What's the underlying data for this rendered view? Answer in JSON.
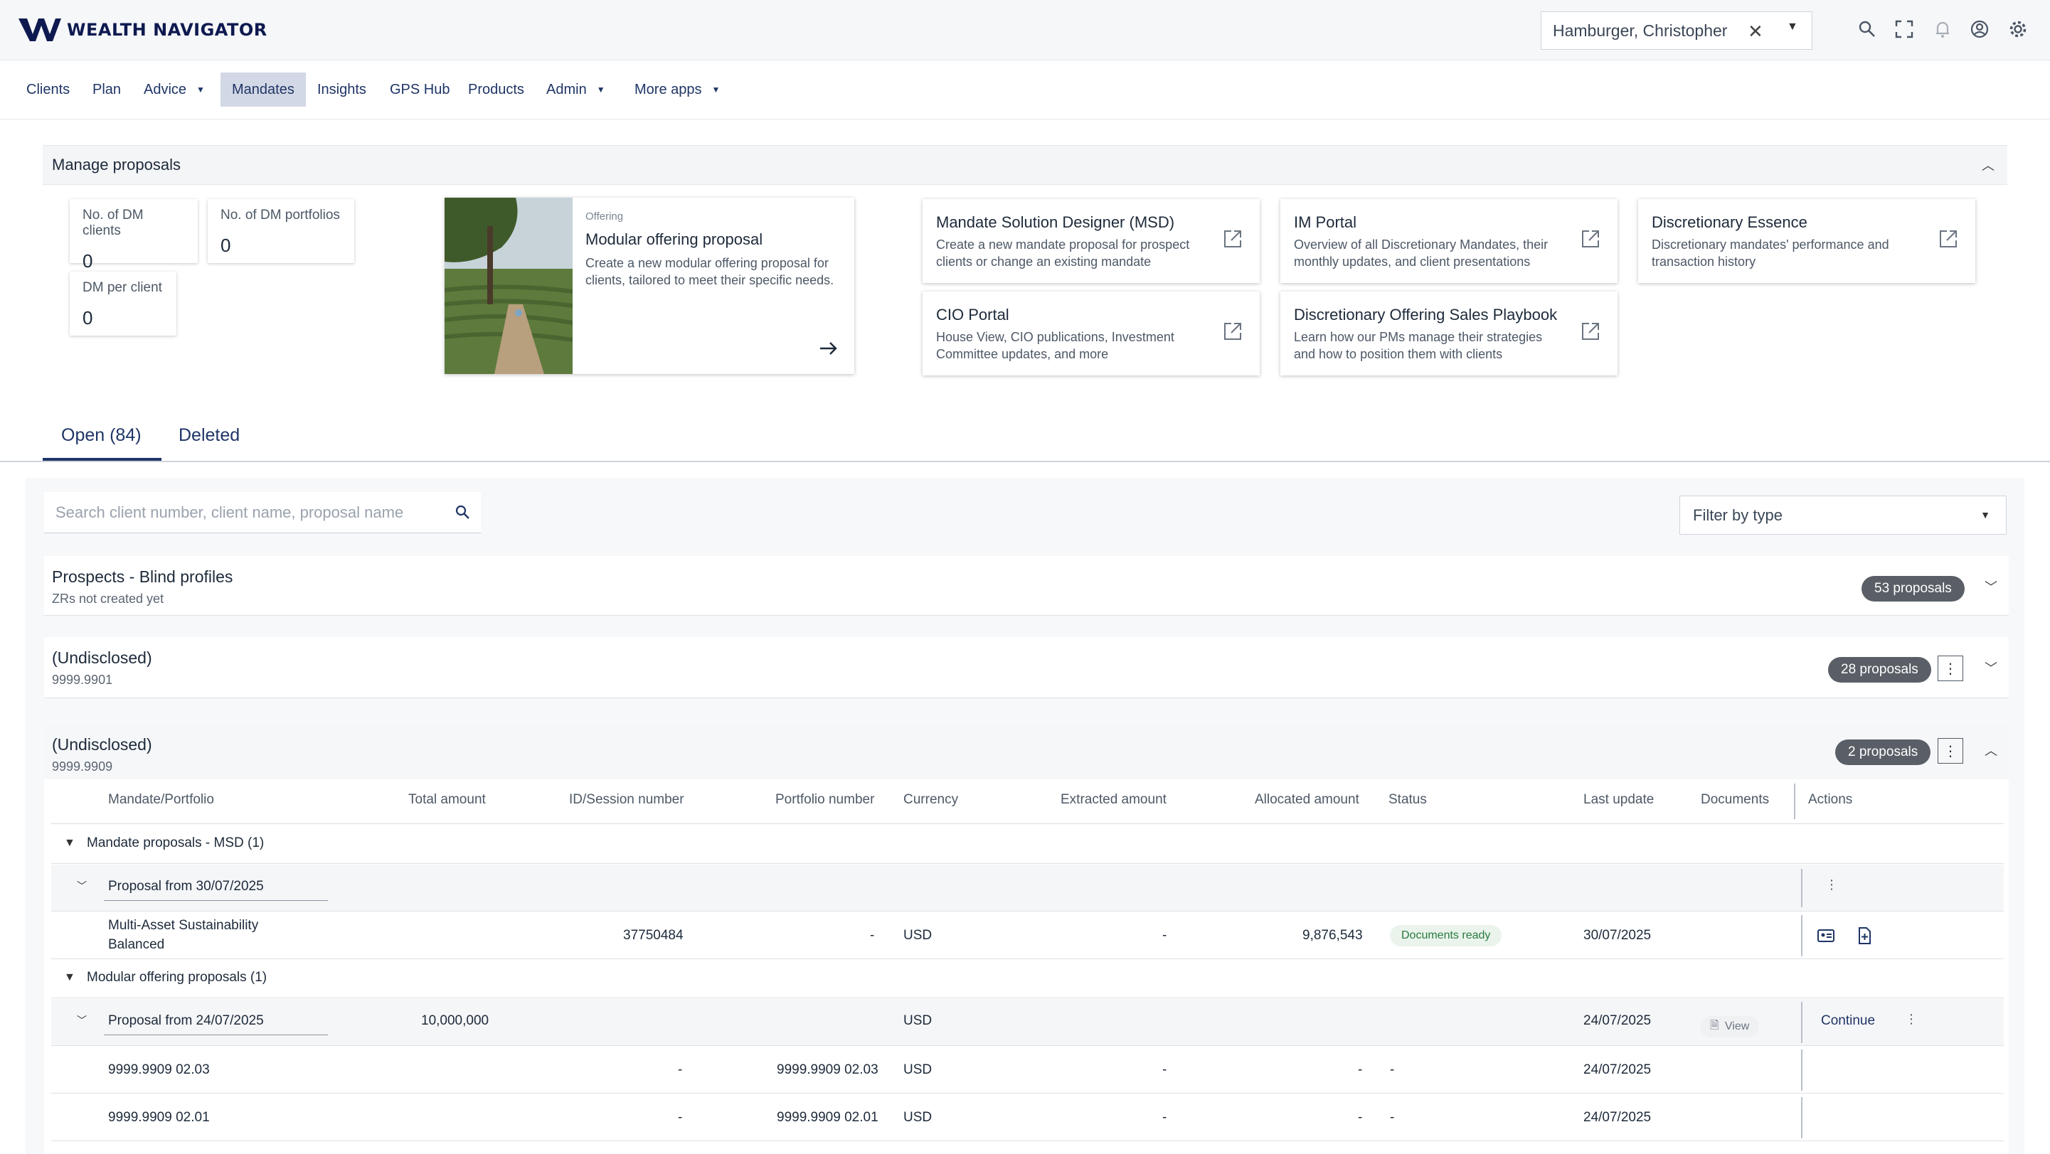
{
  "header": {
    "logo_text": "WEALTH NAVIGATOR",
    "client_name": "Hamburger, Christopher"
  },
  "nav": {
    "items": [
      {
        "label": "Clients"
      },
      {
        "label": "Plan"
      },
      {
        "label": "Advice",
        "has_dropdown": true
      },
      {
        "label": "Mandates",
        "active": true
      },
      {
        "label": "Insights"
      },
      {
        "label": "GPS Hub"
      },
      {
        "label": "Products"
      },
      {
        "label": "Admin",
        "has_dropdown": true
      },
      {
        "label": "More apps",
        "has_dropdown": true
      }
    ]
  },
  "manage": {
    "title": "Manage proposals",
    "stats": [
      {
        "label": "No. of DM clients",
        "value": "0"
      },
      {
        "label": "No. of DM portfolios",
        "value": "0"
      },
      {
        "label": "DM per client",
        "value": "0"
      }
    ],
    "offering": {
      "tag": "Offering",
      "title": "Modular offering proposal",
      "description": "Create a new modular offering proposal for clients, tailored to meet their specific needs."
    },
    "links": [
      {
        "title": "Mandate Solution Designer (MSD)",
        "description": "Create a new mandate proposal for prospect clients or change an existing mandate"
      },
      {
        "title": "IM Portal",
        "description": "Overview of all Discretionary Mandates, their monthly updates, and client presentations"
      },
      {
        "title": "Discretionary Essence",
        "description": "Discretionary mandates' performance and transaction history"
      },
      {
        "title": "CIO Portal",
        "description": "House View, CIO publications, Investment Committee updates, and more"
      },
      {
        "title": "Discretionary Offering Sales Playbook",
        "description": "Learn how our PMs manage their strategies and how to position them with clients"
      }
    ]
  },
  "tabs": {
    "open": "Open (84)",
    "deleted": "Deleted"
  },
  "filters": {
    "search_placeholder": "Search client number, client name, proposal name",
    "filter_label": "Filter by type"
  },
  "groups": [
    {
      "name": "Prospects - Blind profiles",
      "sub": "ZRs not created yet",
      "count": "53 proposals"
    },
    {
      "name": "(Undisclosed)",
      "sub": "9999.9901",
      "count": "28 proposals"
    },
    {
      "name": "(Undisclosed)",
      "sub": "9999.9909",
      "count": "2 proposals"
    }
  ],
  "table": {
    "columns": [
      "Mandate/Portfolio",
      "Total amount",
      "ID/Session number",
      "Portfolio number",
      "Currency",
      "Extracted amount",
      "Allocated amount",
      "Status",
      "Last update",
      "Documents",
      "Actions"
    ],
    "sections": [
      {
        "title": "Mandate proposals - MSD (1)",
        "proposal": "Proposal from 30/07/2025",
        "rows": [
          {
            "name_line1": "Multi-Asset Sustainability",
            "name_line2": "Balanced",
            "id": "37750484",
            "portfolio": "-",
            "currency": "USD",
            "extracted": "-",
            "allocated": "9,876,543",
            "status": "Documents ready",
            "updated": "30/07/2025"
          }
        ]
      },
      {
        "title": "Modular offering proposals (1)",
        "proposal": "Proposal from 24/07/2025",
        "proposal_total": "10,000,000",
        "proposal_currency": "USD",
        "proposal_updated": "24/07/2025",
        "proposal_doc": "View",
        "proposal_action": "Continue",
        "rows": [
          {
            "name": "9999.9909 02.03",
            "id": "-",
            "portfolio": "9999.9909 02.03",
            "currency": "USD",
            "extracted": "-",
            "allocated": "-",
            "status": "-",
            "updated": "24/07/2025"
          },
          {
            "name": "9999.9909 02.01",
            "id": "-",
            "portfolio": "9999.9909 02.01",
            "currency": "USD",
            "extracted": "-",
            "allocated": "-",
            "status": "-",
            "updated": "24/07/2025"
          }
        ]
      }
    ]
  },
  "colors": {
    "brand": "#0e1a4f",
    "nav_text": "#1f3566",
    "active_nav": "#d3d8e6",
    "pill": "#5a5f67",
    "status_green": "#2a7a3e"
  }
}
